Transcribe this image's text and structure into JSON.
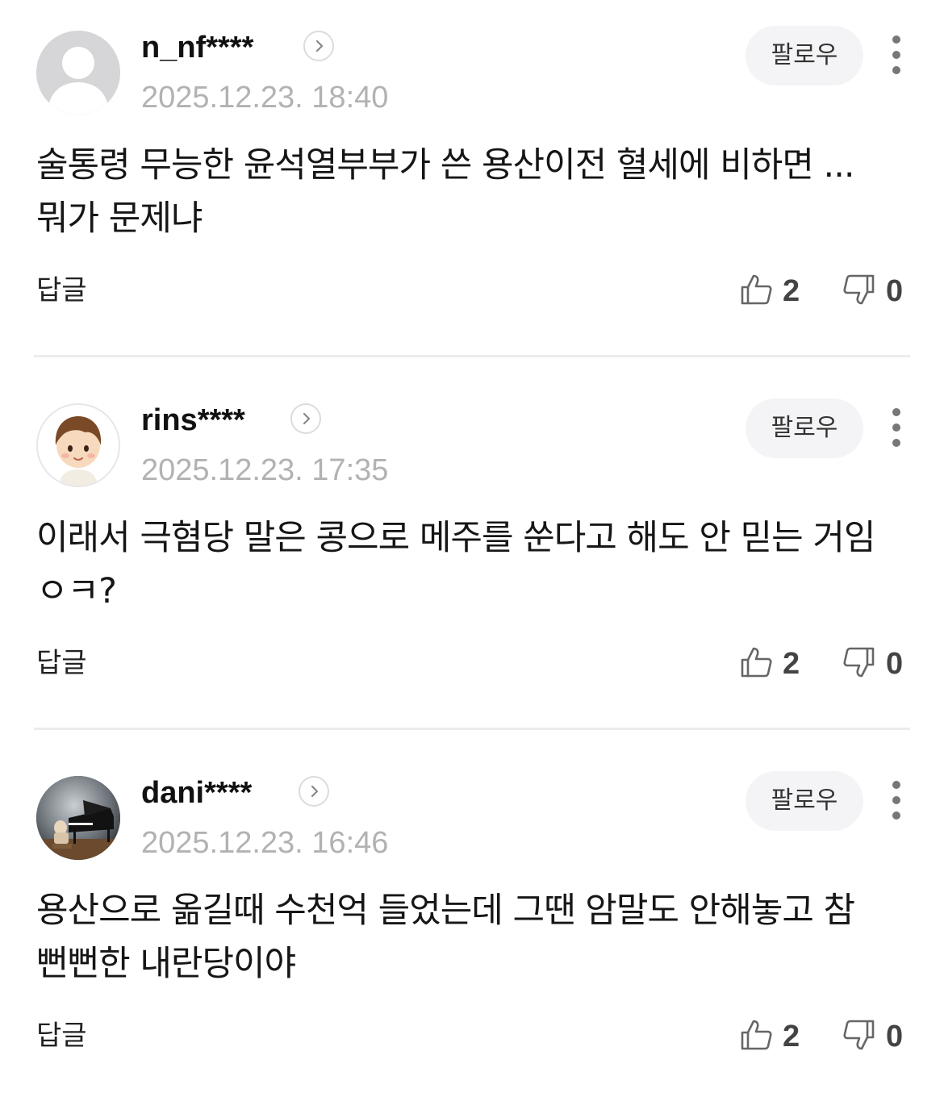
{
  "comments": [
    {
      "username": "n_nf****",
      "timestamp": "2025.12.23. 18:40",
      "text": "술통령 무능한 윤석열부부가 쓴 용산이전 혈세에 비하면 ... 뭐가 문제냐",
      "follow_label": "팔로우",
      "reply_label": "답글",
      "likes": "2",
      "dislikes": "0",
      "avatar": "default-user-icon"
    },
    {
      "username": "rins****",
      "timestamp": "2025.12.23. 17:35",
      "text": "이래서 극혐당 말은 콩으로 메주를 쑨다고 해도 안 믿는 거임 ㅇㅋ?",
      "follow_label": "팔로우",
      "reply_label": "답글",
      "likes": "2",
      "dislikes": "0",
      "avatar": "cartoon-child-avatar"
    },
    {
      "username": "dani****",
      "timestamp": "2025.12.23. 16:46",
      "text": "용산으로 옮길때 수천억 들었는데 그땐 암말도 안해놓고 참 뻔뻔한 내란당이야",
      "follow_label": "팔로우",
      "reply_label": "답글",
      "likes": "2",
      "dislikes": "0",
      "avatar": "piano-photo-avatar"
    }
  ],
  "colors": {
    "text": "#161616",
    "timestamp": "#b2b2b2",
    "follow_bg": "#f4f4f6",
    "divider": "#ececec",
    "icon": "#777777"
  }
}
